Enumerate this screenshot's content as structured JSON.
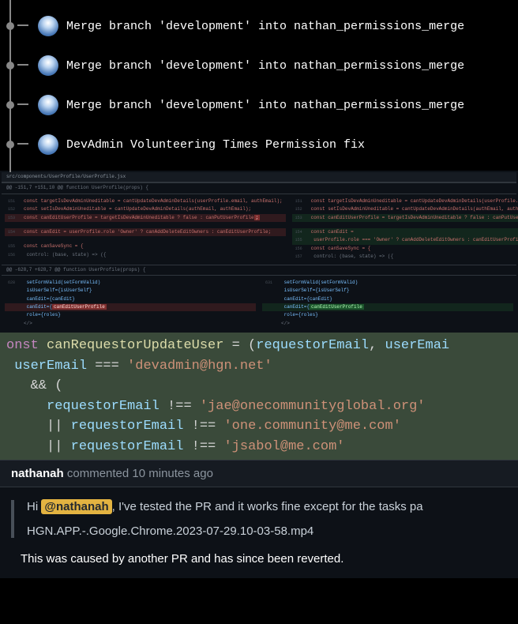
{
  "commits": [
    {
      "message": "Merge branch 'development' into nathan_permissions_merge"
    },
    {
      "message": "Merge branch 'development' into nathan_permissions_merge"
    },
    {
      "message": "Merge branch 'development' into nathan_permissions_merge"
    },
    {
      "message": "DevAdmin Volunteering Times Permission fix"
    }
  ],
  "diff": {
    "file_path": "src/components/UserProfile/UserProfile.jsx",
    "hunk1": "@@ -151,7 +151,10 @@ function UserProfile(props) {",
    "left_lines": {
      "a": "const targetIsDevAdminUneditable = cantUpdateDevAdminDetails(userProfile.email, authEmail);",
      "b": "const setIsDevAdminUneditable = cantUpdateDevAdminDetails(authEmail, authEmail);",
      "c": "const canEditUserProfile = targetIsDevAdminUneditable ? false : canPutUserProfile",
      "d": "const canEdit = userProfile.role   'Owner' ? canAddDeleteEditOwners : canEditUserProfile;",
      "e": "const canSaveSync = {",
      "f": "  control: (base, state) => ({",
      "g": "    setFormValid(setFormValid)",
      "h": "    isUserSelf={isUserSelf}",
      "i": "    canEdit={canEdit}",
      "j": "    canEdit={",
      "k": "    role={roles}"
    },
    "right_lines": {
      "a": "const targetIsDevAdminUneditable = cantUpdateDevAdminDetails(userProfile.email, authEmail);",
      "b": "const setIsDevAdminUneditable = cantUpdateDevAdminDetails(authEmail, authEmail);",
      "c": "const canEditUserProfile = targetIsDevAdminUneditable ? false : canPutUserProfile",
      "d": "const canEdit =",
      "e": "  userProfile.role === 'Owner' ? canAddDeleteEditOwners : canEditUserProfile || isUserSelf;",
      "f": "const canSaveSync = {",
      "g": "  control: (base, state) => ({",
      "h": "    setFormValid(setFormValid)",
      "i": "    isUserSelf={isUserSelf}",
      "j": "    canEdit={canEdit}",
      "k": "    canEdit={",
      "l": "    role={roles}"
    },
    "line_nums": {
      "l1": "151",
      "l2": "152",
      "l3": "153",
      "l4": "154",
      "l5": "155",
      "l6": "156",
      "l7": "157",
      "r1": "151",
      "r2": "152",
      "r3": "153",
      "r4": "154",
      "r5": "155",
      "r6": "156",
      "r7": "157",
      "h2l": "628",
      "h2r": "631"
    },
    "hunk2": "@@ -628,7 +628,7 @@ function UserProfile(props) {"
  },
  "code_zoom": {
    "l1_pre": "onst ",
    "l1_fn": "canRequestorUpdateUser",
    "l1_eq": " = (",
    "l1_p1": "requestorEmail",
    "l1_c": ", ",
    "l1_p2": "userEmai",
    "l2_var": "userEmail",
    "l2_op": " === ",
    "l2_str": "'devadmin@hgn.net'",
    "l3": "&& (",
    "l4_var": "requestorEmail",
    "l4_op": " !== ",
    "l4_str": "'jae@onecommunityglobal.org'",
    "l5_pre": "|| ",
    "l5_var": "requestorEmail",
    "l5_op": " !== ",
    "l5_str": "'one.community@me.com'",
    "l6_pre": "|| ",
    "l6_var": "requestorEmail",
    "l6_op": " !== ",
    "l6_str": "'jsabol@me.com'"
  },
  "comment": {
    "author": "nathanah",
    "time_text": " commented 10 minutes ago",
    "quote": {
      "greeting": "Hi ",
      "mention": "@nathanah",
      "after_mention": ", I've tested the PR and it works fine except for the tasks pa",
      "attachment": "HGN.APP.-.Google.Chrome.2023-07-29.10-03-58.mp4"
    },
    "reply": "This was caused by another PR and has since been reverted."
  }
}
